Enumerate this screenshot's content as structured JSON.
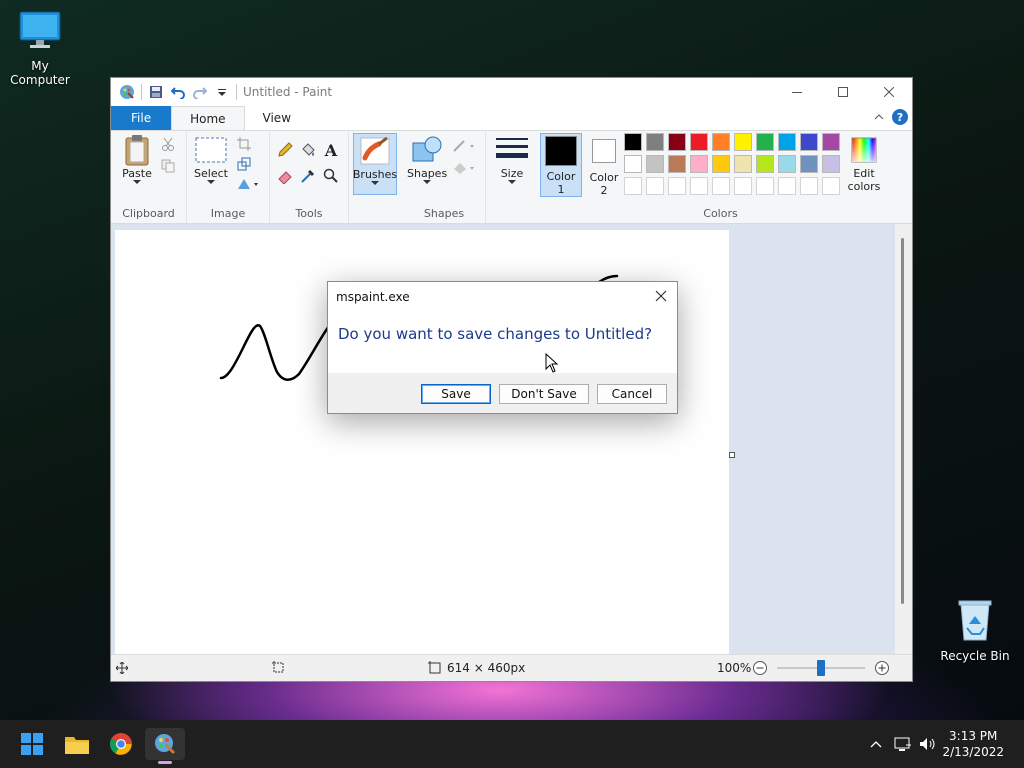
{
  "desktop": {
    "icons": [
      {
        "label": "My Computer"
      },
      {
        "label": "Recycle Bin"
      }
    ]
  },
  "window": {
    "title": "Untitled - Paint",
    "tabs": [
      "File",
      "Home",
      "View"
    ],
    "ribbon": {
      "clipboard": {
        "paste": "Paste",
        "group": "Clipboard"
      },
      "image": {
        "select": "Select",
        "group": "Image"
      },
      "tools": {
        "group": "Tools"
      },
      "brushes": {
        "label": "Brushes"
      },
      "shapes": {
        "label": "Shapes",
        "group": "Shapes"
      },
      "size": {
        "label": "Size"
      },
      "color1": {
        "line1": "Color",
        "line2": "1"
      },
      "color2": {
        "line1": "Color",
        "line2": "2"
      },
      "edit_colors": {
        "line1": "Edit",
        "line2": "colors"
      },
      "colors_group": "Colors",
      "palette_row1": [
        "#000000",
        "#7f7f7f",
        "#880015",
        "#ed1c24",
        "#ff7f27",
        "#fff200",
        "#22b14c",
        "#00a2e8",
        "#3f48cc",
        "#a349a4"
      ],
      "palette_row2": [
        "#ffffff",
        "#c3c3c3",
        "#b97a57",
        "#ffaec9",
        "#ffc90e",
        "#efe4b0",
        "#b5e61d",
        "#99d9ea",
        "#7092be",
        "#c8bfe7"
      ],
      "palette_row3": [
        "#ffffff",
        "#ffffff",
        "#ffffff",
        "#ffffff",
        "#ffffff",
        "#ffffff",
        "#ffffff",
        "#ffffff",
        "#ffffff",
        "#ffffff"
      ]
    },
    "status": {
      "canvas_size": "614 × 460px",
      "zoom": "100%",
      "zoom_level": 0.5
    }
  },
  "dialog": {
    "title": "mspaint.exe",
    "message": "Do you want to save changes to Untitled?",
    "save": "Save",
    "dont_save": "Don't Save",
    "cancel": "Cancel"
  },
  "taskbar": {
    "time": "3:13 PM",
    "date": "2/13/2022"
  },
  "colors": {
    "accent": "#1979ca",
    "dialog_text": "#1c3a8e"
  }
}
